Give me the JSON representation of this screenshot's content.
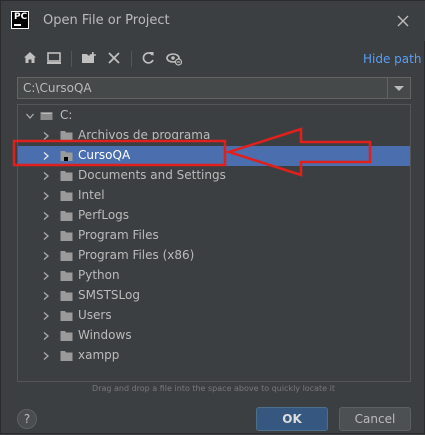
{
  "window": {
    "logo_text": "PC",
    "title": "Open File or Project"
  },
  "toolbar": {
    "buttons": [
      "home-icon",
      "desktop-icon",
      "new-folder-icon",
      "delete-icon",
      "refresh-icon",
      "show-hidden-icon"
    ],
    "hide_path_label": "Hide path"
  },
  "path": {
    "value": "C:\\CursoQA"
  },
  "tree": {
    "root": "C:",
    "items": [
      {
        "label": "Archivos de programa",
        "selected": false
      },
      {
        "label": "CursoQA",
        "selected": true
      },
      {
        "label": "Documents and Settings",
        "selected": false
      },
      {
        "label": "Intel",
        "selected": false
      },
      {
        "label": "PerfLogs",
        "selected": false
      },
      {
        "label": "Program Files",
        "selected": false
      },
      {
        "label": "Program Files (x86)",
        "selected": false
      },
      {
        "label": "Python",
        "selected": false
      },
      {
        "label": "SMSTSLog",
        "selected": false
      },
      {
        "label": "Users",
        "selected": false
      },
      {
        "label": "Windows",
        "selected": false
      },
      {
        "label": "xampp",
        "selected": false
      }
    ]
  },
  "drop_hint": "Drag and drop a file into the space above to quickly locate it",
  "buttons": {
    "help_label": "?",
    "ok_label": "OK",
    "cancel_label": "Cancel"
  },
  "colors": {
    "background": "#3c3f41",
    "selection": "#4b6eaf",
    "link": "#589df6",
    "annotation": "#e0201c"
  }
}
